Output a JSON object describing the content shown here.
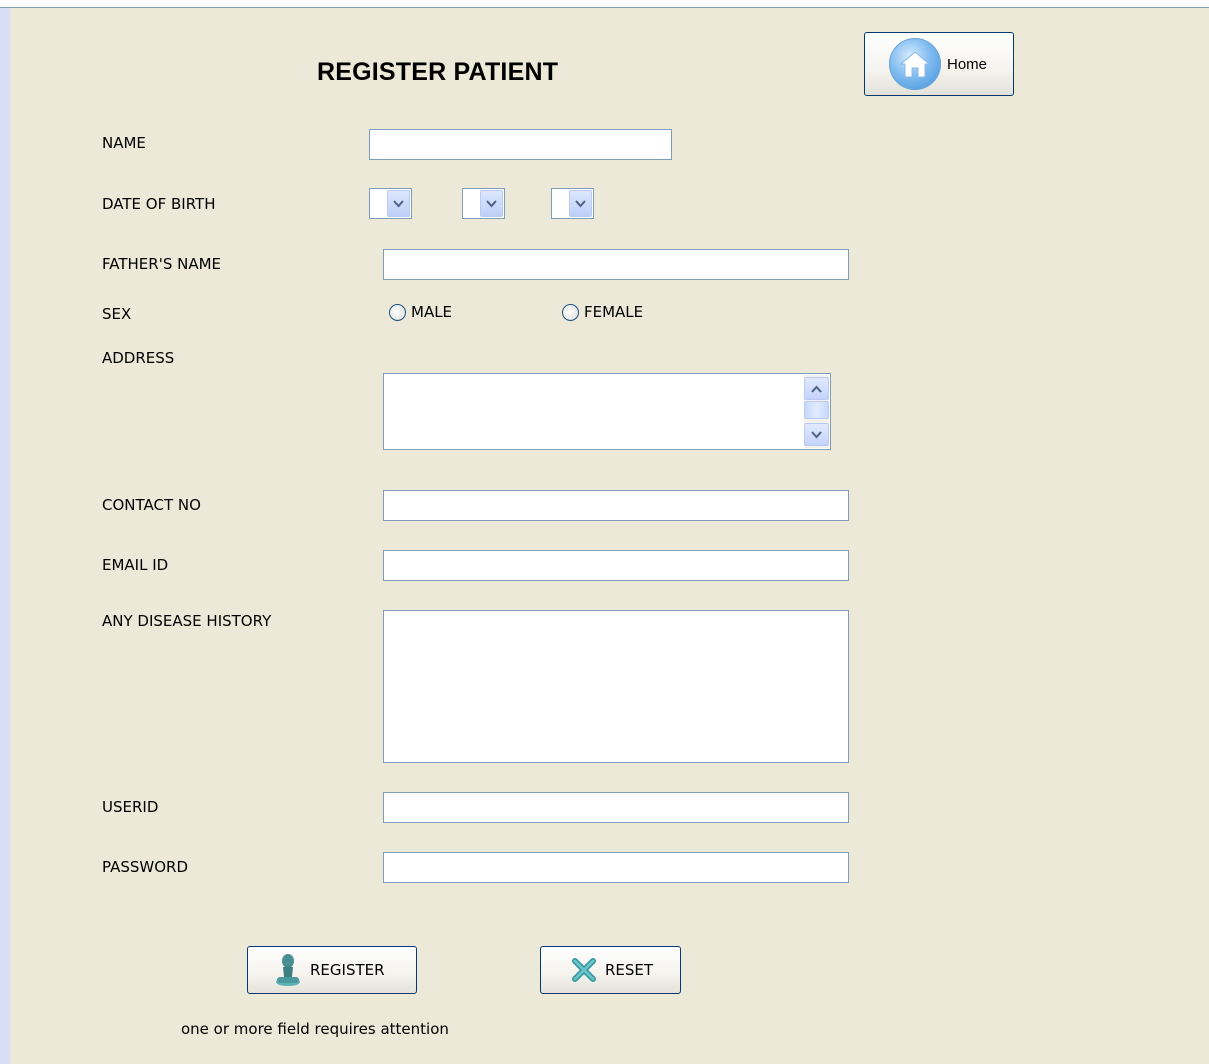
{
  "form": {
    "title": "REGISTER PATIENT",
    "home_button": {
      "label": "Home",
      "icon": "home-icon"
    },
    "labels": {
      "name": "NAME",
      "dob": "DATE OF BIRTH",
      "father": "FATHER'S NAME",
      "sex": "SEX",
      "address": "ADDRESS",
      "contact": "CONTACT NO",
      "email": "EMAIL ID",
      "disease": "ANY DISEASE HISTORY",
      "userid": "USERID",
      "password": "PASSWORD"
    },
    "values": {
      "name": "",
      "father": "",
      "address": "",
      "contact": "",
      "email": "",
      "disease": "",
      "userid": "",
      "password": ""
    },
    "dob_selects": {
      "day": "",
      "month": "",
      "year": ""
    },
    "sex_options": {
      "male": "MALE",
      "female": "FEMALE"
    },
    "buttons": {
      "register": "REGISTER",
      "reset": "RESET"
    },
    "status_message": "one or more field requires attention"
  },
  "colors": {
    "panel_bg": "#ECE9D8",
    "field_border": "#7F9DB9",
    "button_border": "#003C74"
  }
}
